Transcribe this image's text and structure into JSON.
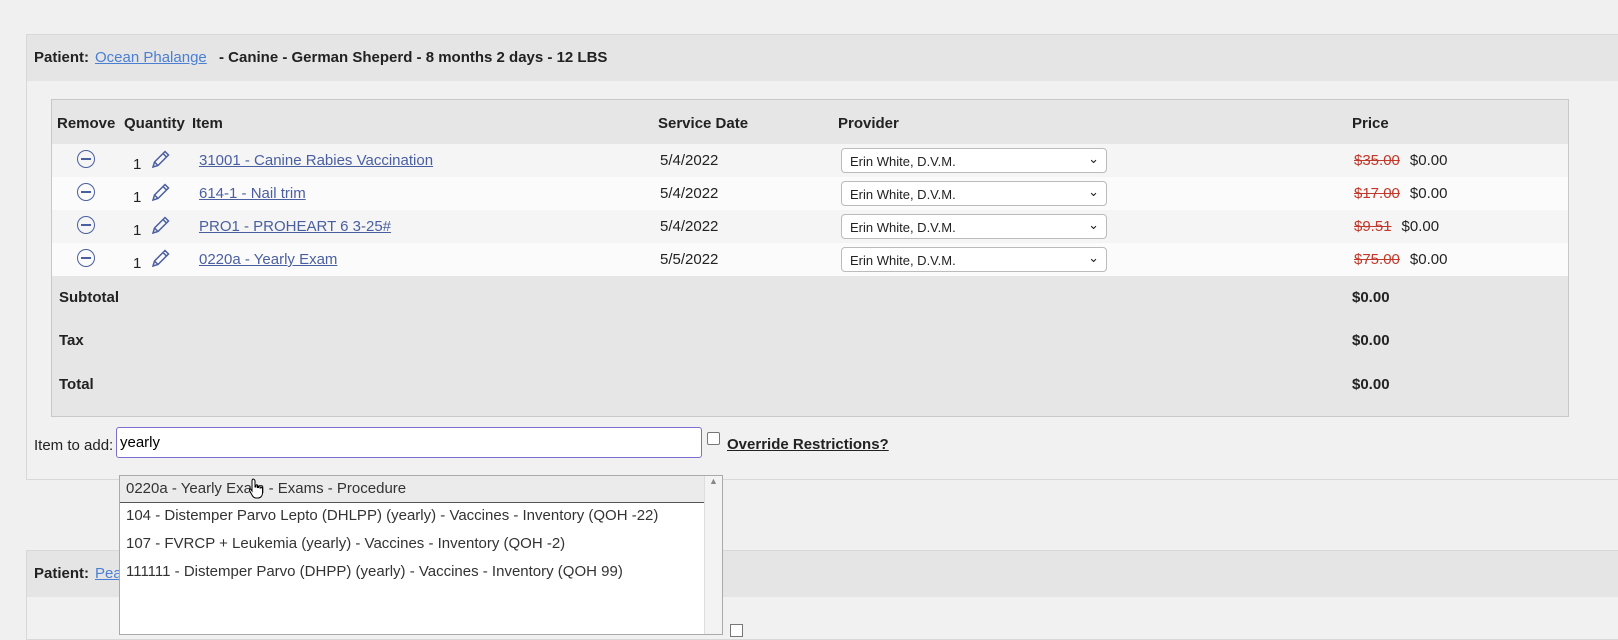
{
  "patient": {
    "label": "Patient:",
    "name": "Ocean Phalange",
    "info": "- Canine - German Sheperd - 8 months 2 days - 12 LBS"
  },
  "table": {
    "headers": {
      "remove": "Remove",
      "quantity": "Quantity",
      "item": "Item",
      "service_date": "Service Date",
      "provider": "Provider",
      "price": "Price"
    },
    "rows": [
      {
        "qty": "1",
        "item": "31001 - Canine Rabies Vaccination",
        "date": "5/4/2022",
        "provider": "Erin White, D.V.M.",
        "old_price": "$35.00",
        "price": "$0.00"
      },
      {
        "qty": "1",
        "item": "614-1 - Nail trim",
        "date": "5/4/2022",
        "provider": "Erin White, D.V.M.",
        "old_price": "$17.00",
        "price": "$0.00"
      },
      {
        "qty": "1",
        "item": "PRO1 - PROHEART 6 3-25#",
        "date": "5/4/2022",
        "provider": "Erin White, D.V.M.",
        "old_price": "$9.51",
        "price": "$0.00"
      },
      {
        "qty": "1",
        "item": "0220a - Yearly Exam",
        "date": "5/5/2022",
        "provider": "Erin White, D.V.M.",
        "old_price": "$75.00",
        "price": "$0.00"
      }
    ],
    "summary": {
      "subtotal_label": "Subtotal",
      "subtotal": "$0.00",
      "tax_label": "Tax",
      "tax": "$0.00",
      "total_label": "Total",
      "total": "$0.00"
    }
  },
  "add_item": {
    "label": "Item to add:",
    "value": "yearly",
    "override_label": "Override Restrictions?"
  },
  "suggestions": [
    "0220a - Yearly Exam - Exams - Procedure",
    "104 - Distemper Parvo Lepto (DHLPP) (yearly) - Vaccines - Inventory (QOH -22)",
    "107 - FVRCP + Leukemia (yearly) - Vaccines - Inventory (QOH -2)",
    "111111 - Distemper Parvo (DHPP) (yearly) - Vaccines - Inventory (QOH 99)"
  ],
  "patient2": {
    "label": "Patient:",
    "name_partial": "Pea"
  },
  "colors": {
    "link": "#4a7fd4",
    "strike_price": "#c0392b",
    "focus_border": "#7a6fd0"
  }
}
